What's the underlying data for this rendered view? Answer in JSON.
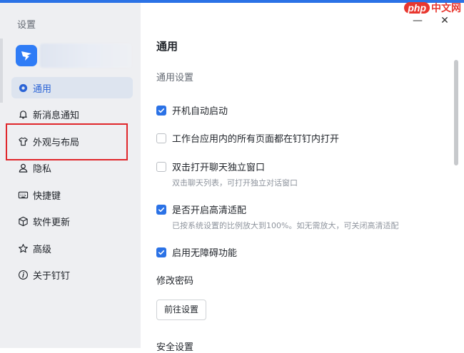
{
  "sidebar": {
    "title": "设置",
    "items": [
      {
        "label": "通用",
        "icon": "settings-icon",
        "active": true
      },
      {
        "label": "新消息通知",
        "icon": "bell-icon",
        "active": false
      },
      {
        "label": "外观与布局",
        "icon": "shirt-icon",
        "active": false
      },
      {
        "label": "隐私",
        "icon": "person-icon",
        "active": false
      },
      {
        "label": "快捷键",
        "icon": "keyboard-icon",
        "active": false
      },
      {
        "label": "软件更新",
        "icon": "cube-icon",
        "active": false
      },
      {
        "label": "高级",
        "icon": "star-icon",
        "active": false
      },
      {
        "label": "关于钉钉",
        "icon": "info-icon",
        "active": false
      }
    ]
  },
  "window": {
    "minimize": "—",
    "close": "✕"
  },
  "watermark": {
    "brand": "php",
    "site": "中文网"
  },
  "main": {
    "heading": "通用",
    "section_general": "通用设置",
    "options": [
      {
        "label": "开机自动启动",
        "checked": true,
        "hint": ""
      },
      {
        "label": "工作台应用内的所有页面都在钉钉内打开",
        "checked": false,
        "hint": ""
      },
      {
        "label": "双击打开聊天独立窗口",
        "checked": false,
        "hint": "双击聊天列表，可打开独立对话窗口"
      },
      {
        "label": "是否开启高清适配",
        "checked": true,
        "hint": "已按系统设置的比例放大到100%。如无需放大，可关闭高清适配"
      },
      {
        "label": "启用无障碍功能",
        "checked": true,
        "hint": ""
      }
    ],
    "section_password": "修改密码",
    "goto_button": "前往设置",
    "section_security": "安全设置"
  },
  "colors": {
    "accent": "#2b72e6",
    "highlight": "#e0262b",
    "sidebar_bg": "#eeeff2"
  }
}
